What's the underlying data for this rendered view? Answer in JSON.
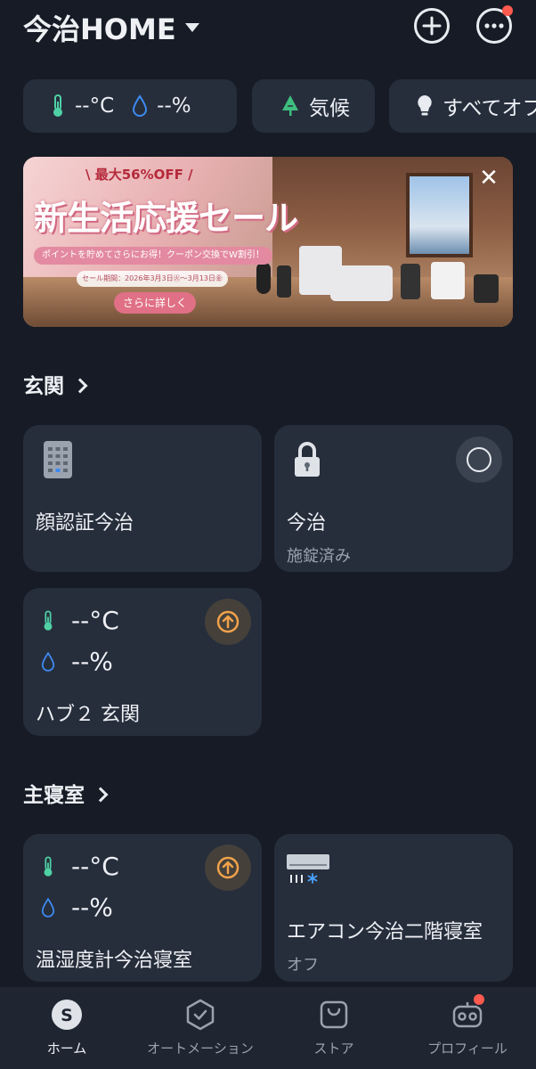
{
  "header": {
    "title": "今治HOME",
    "dropdown_icon": "caret-down-icon",
    "add_icon": "plus-circle-icon",
    "more_icon": "more-circle-icon"
  },
  "chips": {
    "climate_temp": "--°C",
    "climate_humidity": "--%",
    "weather_label": "気候",
    "all_off_label": "すべてオフ"
  },
  "banner": {
    "badge": "\\ 最大56%OFF /",
    "headline": "新生活応援セール",
    "subtitle": "ポイントを貯めてさらにお得！クーポン交換でW割引！",
    "period": "セール期間：2026年3月3日㊋～3月13日㊎",
    "cta": "さらに詳しく",
    "close": "✕"
  },
  "sections": [
    {
      "title": "玄関",
      "cards": [
        {
          "name": "顔認証今治",
          "icon": "keypad-icon"
        },
        {
          "name": "今治",
          "status": "施錠済み",
          "icon": "lock-icon"
        },
        {
          "temperature": "--°C",
          "humidity": "--%",
          "name": "ハブ２ 玄関",
          "icon": "upgrade-icon"
        }
      ]
    },
    {
      "title": "主寝室",
      "cards": [
        {
          "temperature": "--°C",
          "humidity": "--%",
          "name": "温湿度計今治寝室",
          "icon": "upgrade-icon"
        },
        {
          "name": "エアコン今治二階寝室",
          "status": "オフ",
          "icon": "air-conditioner-icon"
        }
      ]
    }
  ],
  "tabs": [
    {
      "label": "ホーム",
      "icon": "home-s-icon",
      "active": true
    },
    {
      "label": "オートメーション",
      "icon": "automation-icon"
    },
    {
      "label": "ストア",
      "icon": "store-bag-icon"
    },
    {
      "label": "プロフィール",
      "icon": "profile-robot-icon"
    }
  ],
  "colors": {
    "background": "#161b25",
    "card": "#262e3c",
    "accent_orange": "#f0a24b",
    "temp_green": "#4fd1a5",
    "humidity_blue": "#3d8bf2",
    "notification_red": "#ff5a4f"
  }
}
